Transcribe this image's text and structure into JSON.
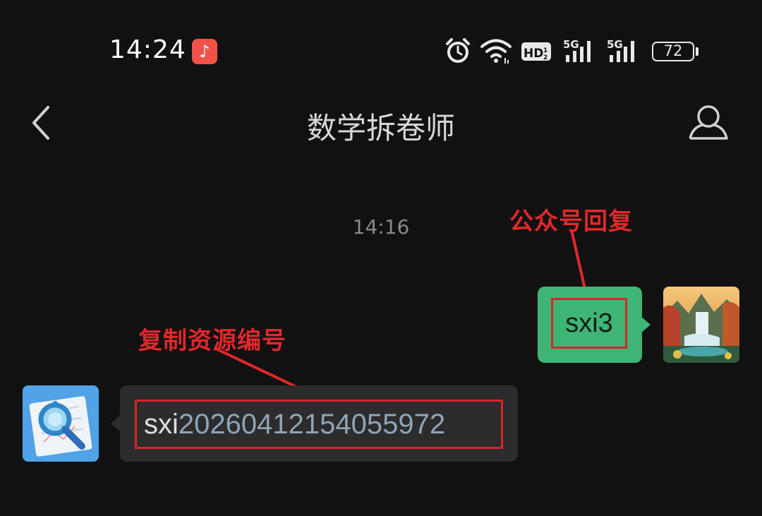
{
  "status_bar": {
    "time": "14:24",
    "music_icon": "music-note-icon",
    "icons": [
      "alarm-icon",
      "wifi-icon",
      "hd-icon",
      "signal-5g-icon",
      "signal-5g-icon"
    ],
    "hd_label": "HD",
    "hd_sub": "2",
    "signal_label": "5G",
    "battery_level": "72"
  },
  "nav": {
    "title": "数学拆卷师",
    "back_icon": "chevron-left-icon",
    "profile_icon": "person-icon"
  },
  "chat": {
    "timestamp": "14:16",
    "messages": [
      {
        "side": "right",
        "text": "sxi3",
        "bubble_color": "#3eb575"
      },
      {
        "side": "left",
        "prefix": "sxi",
        "number": "20260412154055972",
        "bubble_color": "#2c2c2c"
      }
    ]
  },
  "annotations": {
    "top_label": "公众号回复",
    "left_label": "复制资源编号",
    "color": "#e0282c"
  }
}
